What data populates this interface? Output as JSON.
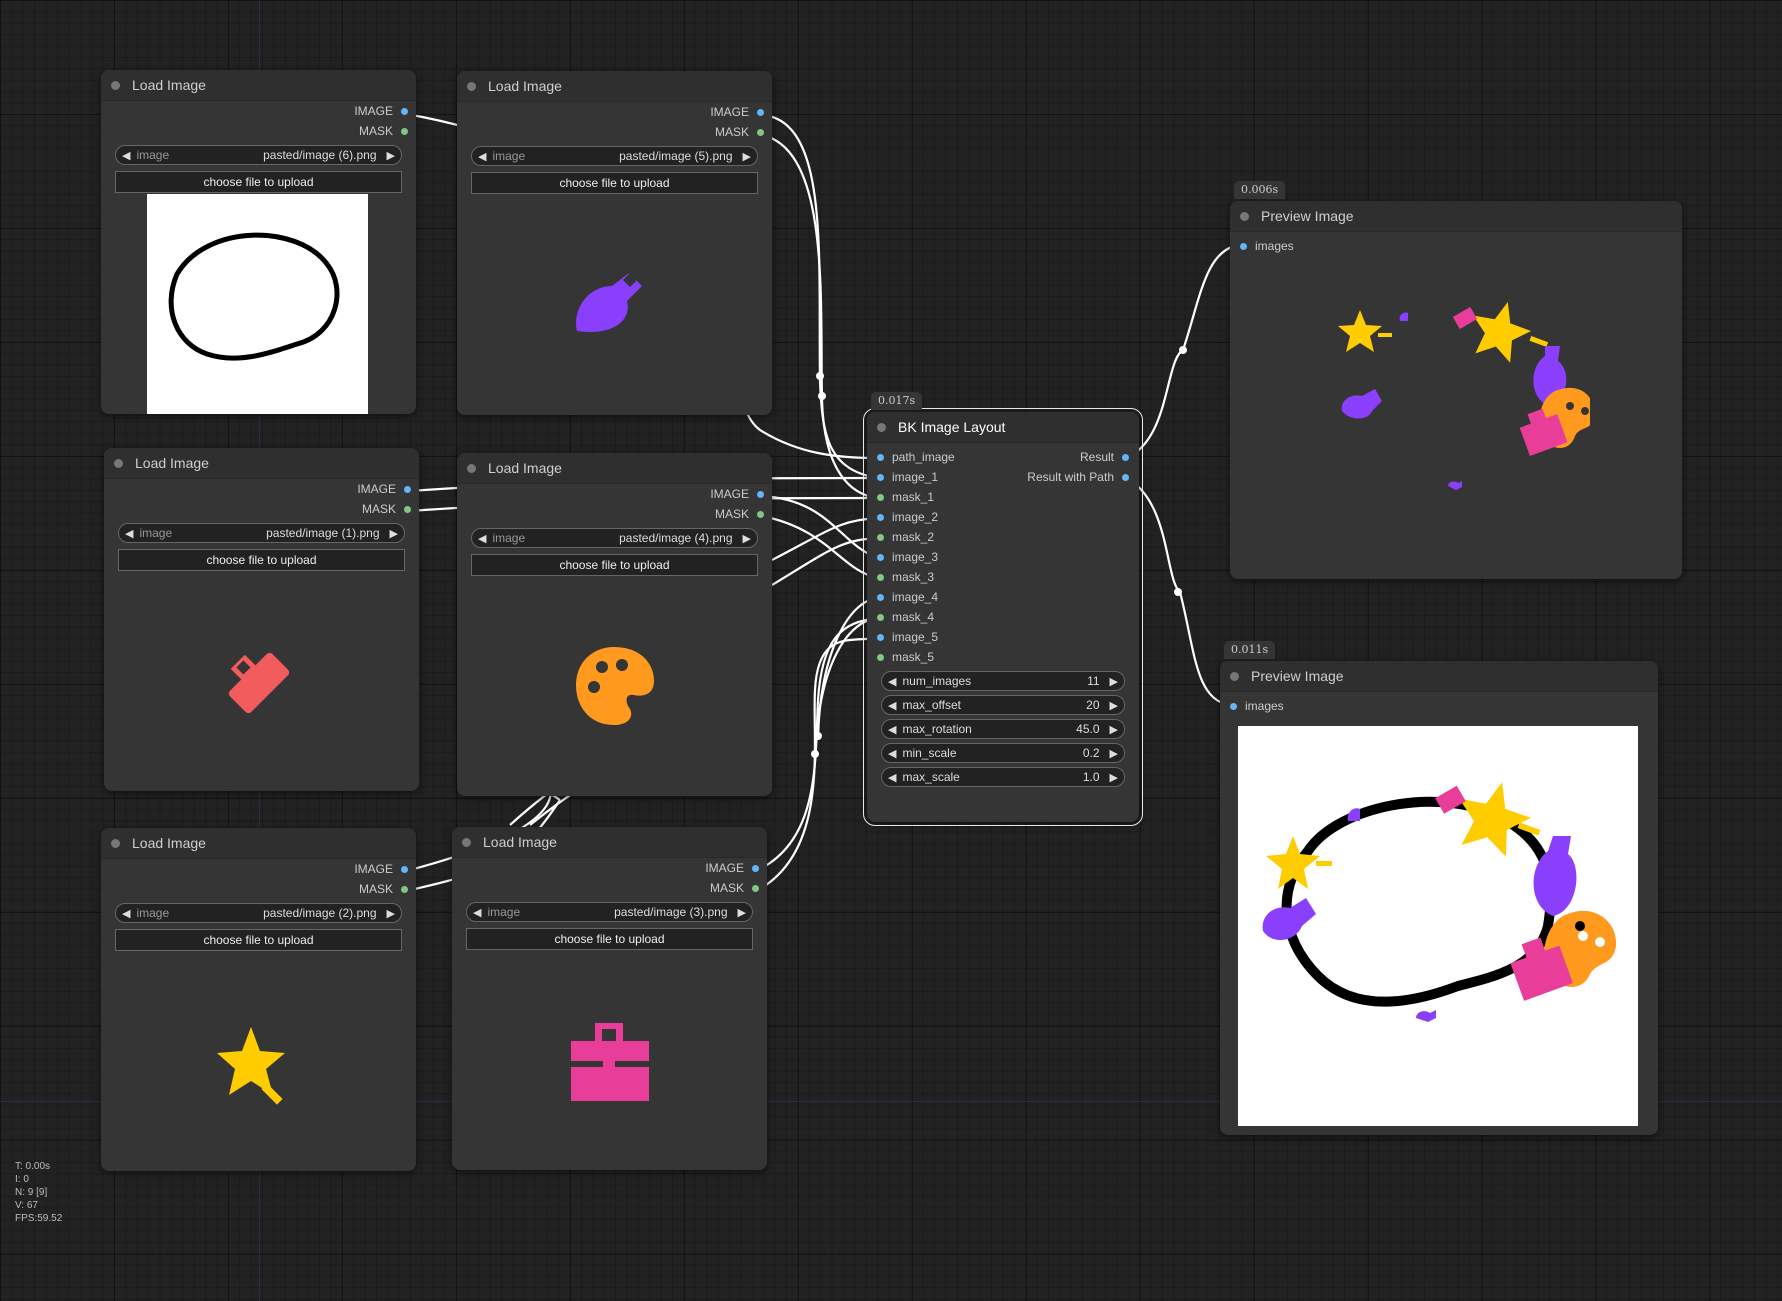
{
  "load_nodes": [
    {
      "title": "Load Image",
      "out_image": "IMAGE",
      "out_mask": "MASK",
      "widget_label": "image",
      "file": "pasted/image (6).png",
      "upload": "choose file to upload",
      "preview": "outline-loop"
    },
    {
      "title": "Load Image",
      "out_image": "IMAGE",
      "out_mask": "MASK",
      "widget_label": "image",
      "file": "pasted/image (5).png",
      "upload": "choose file to upload",
      "preview": "purple-paintbrush-icon"
    },
    {
      "title": "Load Image",
      "out_image": "IMAGE",
      "out_mask": "MASK",
      "widget_label": "image",
      "file": "pasted/image (1).png",
      "upload": "choose file to upload",
      "preview": "red-roller-brush-icon"
    },
    {
      "title": "Load Image",
      "out_image": "IMAGE",
      "out_mask": "MASK",
      "widget_label": "image",
      "file": "pasted/image (4).png",
      "upload": "choose file to upload",
      "preview": "orange-palette-icon"
    },
    {
      "title": "Load Image",
      "out_image": "IMAGE",
      "out_mask": "MASK",
      "widget_label": "image",
      "file": "pasted/image (2).png",
      "upload": "choose file to upload",
      "preview": "yellow-magic-star-icon"
    },
    {
      "title": "Load Image",
      "out_image": "IMAGE",
      "out_mask": "MASK",
      "widget_label": "image",
      "file": "pasted/image (3).png",
      "upload": "choose file to upload",
      "preview": "pink-toolbox-icon"
    }
  ],
  "layout_node": {
    "timing": "0.017s",
    "title": "BK Image Layout",
    "inputs": [
      "path_image",
      "image_1",
      "mask_1",
      "image_2",
      "mask_2",
      "image_3",
      "mask_3",
      "image_4",
      "mask_4",
      "image_5",
      "mask_5"
    ],
    "outputs": [
      "Result",
      "Result with Path"
    ],
    "widgets": [
      {
        "name": "num_images",
        "value": "11"
      },
      {
        "name": "max_offset",
        "value": "20"
      },
      {
        "name": "max_rotation",
        "value": "45.0"
      },
      {
        "name": "min_scale",
        "value": "0.2"
      },
      {
        "name": "max_scale",
        "value": "1.0"
      }
    ]
  },
  "preview_nodes": [
    {
      "timing": "0.006s",
      "title": "Preview Image",
      "input": "images"
    },
    {
      "timing": "0.011s",
      "title": "Preview Image",
      "input": "images"
    }
  ],
  "stats": [
    "T: 0.00s",
    "I: 0",
    "N: 9 [9]",
    "V: 67",
    "FPS:59.52"
  ],
  "colors": {
    "image_socket": "#64b5f6",
    "mask_socket": "#81c784",
    "purple": "#8a3ffc",
    "red": "#f25c5c",
    "orange": "#ff9a1f",
    "yellow": "#ffcc00",
    "pink": "#e83e9a"
  }
}
